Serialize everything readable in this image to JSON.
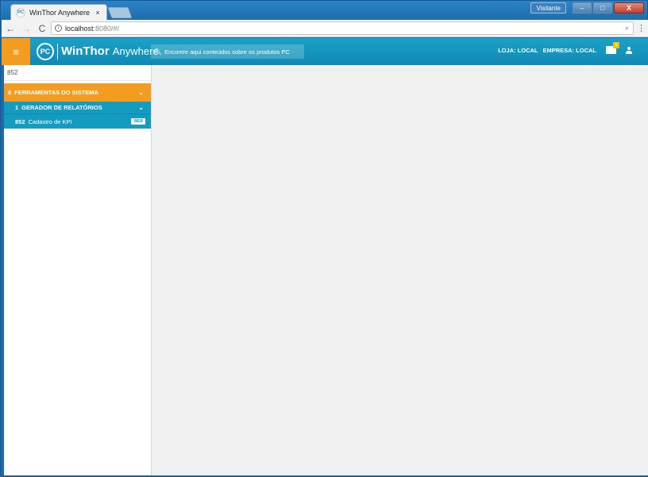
{
  "browser": {
    "tab": {
      "favicon": "PC",
      "title": "WinThor Anywhere",
      "close": "×"
    },
    "profile_label": "Visitante",
    "window_controls": {
      "minimize": "–",
      "maximize": "□",
      "close": "X"
    },
    "address": {
      "info": "i",
      "host": "localhost",
      "rest": ":8080/#/"
    },
    "zoom": "⌕",
    "menu": "⋮"
  },
  "app": {
    "menu_icon": "≡",
    "logo": "PC",
    "brand_bold": "WinThor",
    "brand_light": "Anywhere",
    "search_placeholder": "Encontre aqui conteúdos sobre os produtos PC",
    "store_label": "LOJA: LOCAL",
    "company_label": "EMPRESA: LOCAL",
    "mail_badge": "1"
  },
  "sidebar": {
    "search_value": "852",
    "group": {
      "code": "8",
      "label": "FERRAMENTAS DO SISTEMA"
    },
    "subgroup": {
      "code": "1",
      "label": "GERADOR DE RELATÓRIOS"
    },
    "item": {
      "code": "852",
      "label": "Cadastro de KPI",
      "badge": "WEB"
    }
  },
  "colors": {
    "accent": "#f39c1f",
    "header": "#1089b4",
    "menu": "#139bc0"
  }
}
